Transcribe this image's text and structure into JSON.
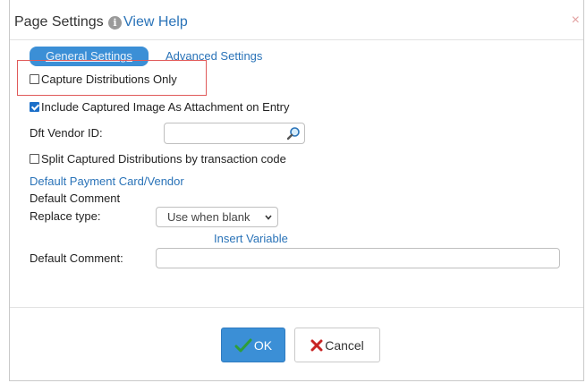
{
  "dialog": {
    "title": "Page Settings",
    "help_link": "View Help",
    "close_symbol": "×"
  },
  "tabs": [
    {
      "label": "General Settings",
      "active": true
    },
    {
      "label": "Advanced Settings",
      "active": false
    }
  ],
  "options": {
    "capture_distributions_only": {
      "label": "Capture Distributions Only",
      "checked": false
    },
    "include_captured_image": {
      "label": "Include Captured Image As Attachment on Entry",
      "checked": true
    },
    "split_captured_distributions": {
      "label": "Split Captured Distributions by transaction code",
      "checked": false
    }
  },
  "vendor": {
    "label": "Dft Vendor ID:",
    "value": ""
  },
  "payment_link": "Default Payment Card/Vendor",
  "comment_section": {
    "heading": "Default Comment",
    "replace_label": "Replace type:",
    "replace_value": "Use when blank",
    "insert_variable": "Insert Variable",
    "comment_label": "Default Comment:",
    "comment_value": ""
  },
  "buttons": {
    "ok": "OK",
    "cancel": "Cancel"
  },
  "colors": {
    "accent": "#3b8fd6",
    "link": "#2a73b8",
    "highlight": "#e05a5a"
  }
}
